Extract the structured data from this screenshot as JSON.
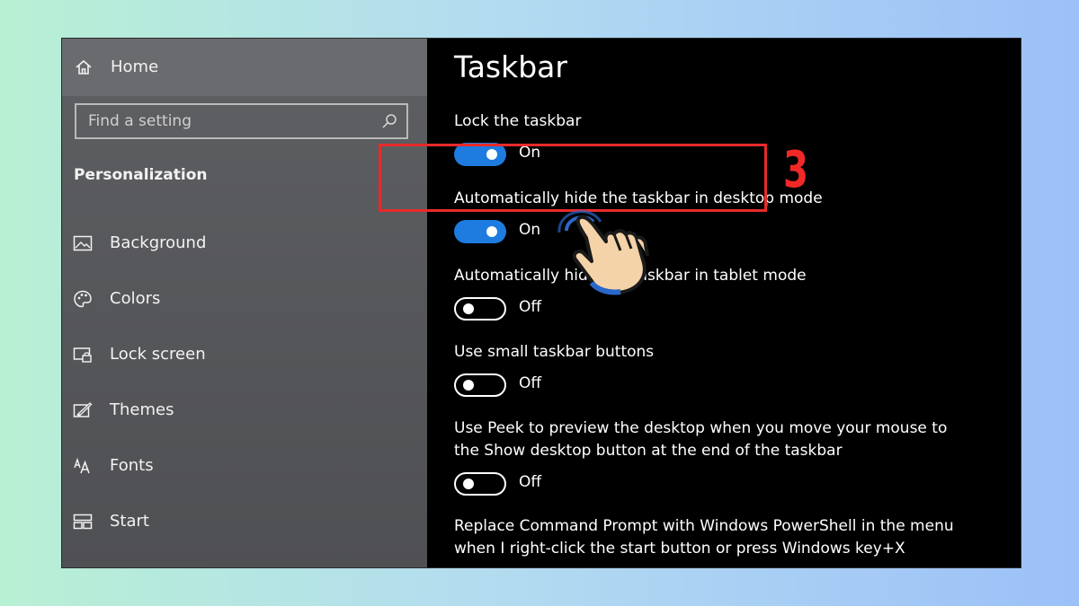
{
  "sidebar": {
    "home_label": "Home",
    "search_placeholder": "Find a setting",
    "section_title": "Personalization",
    "items": [
      {
        "label": "Background",
        "icon": "picture-icon"
      },
      {
        "label": "Colors",
        "icon": "palette-icon"
      },
      {
        "label": "Lock screen",
        "icon": "lock-screen-icon"
      },
      {
        "label": "Themes",
        "icon": "themes-icon"
      },
      {
        "label": "Fonts",
        "icon": "fonts-icon"
      },
      {
        "label": "Start",
        "icon": "start-icon"
      }
    ]
  },
  "main": {
    "title": "Taskbar",
    "settings": [
      {
        "label": "Lock the taskbar",
        "state": "On",
        "on": true
      },
      {
        "label": "Automatically hide the taskbar in desktop mode",
        "state": "On",
        "on": true
      },
      {
        "label": "Automatically hide the taskbar in tablet mode",
        "state": "Off",
        "on": false
      },
      {
        "label": "Use small taskbar buttons",
        "state": "Off",
        "on": false
      },
      {
        "label": "Use Peek to preview the desktop when you move your mouse to the Show desktop button at the end of the taskbar",
        "state": "Off",
        "on": false
      },
      {
        "label": "Replace Command Prompt with Windows PowerShell in the menu when I right-click the start button or press Windows key+X"
      }
    ]
  },
  "annotation": {
    "step_number": "3",
    "highlight_color": "#e82a2a"
  },
  "colors": {
    "toggle_on": "#1e7be0",
    "sidebar_bg": "#58595c",
    "main_bg": "#000000"
  }
}
